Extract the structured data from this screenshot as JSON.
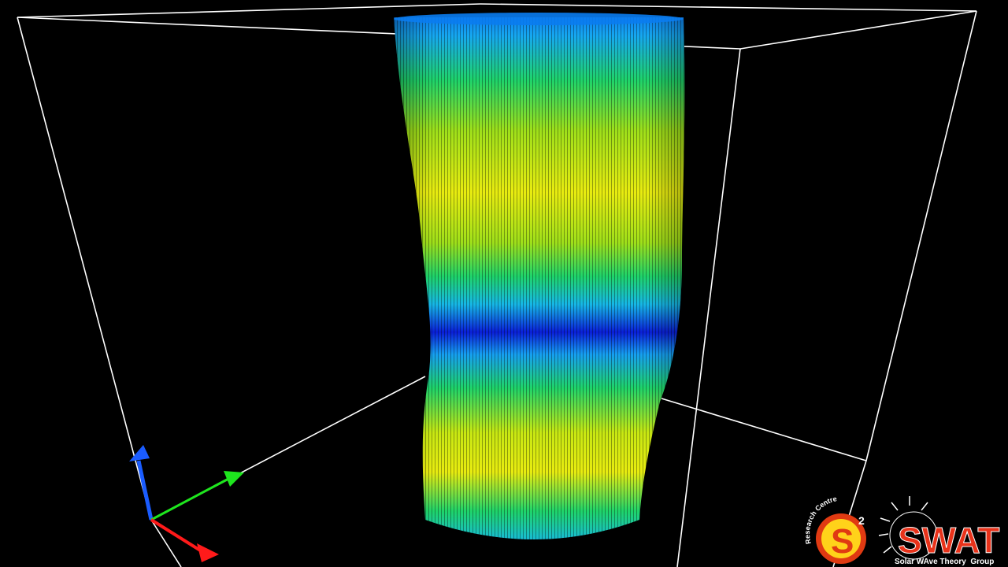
{
  "scene": {
    "background": "#000000",
    "box_edge_color": "#ffffff",
    "colormap": [
      "#0a1fd8",
      "#0a6cf0",
      "#16b8e6",
      "#1fd46a",
      "#8fe01a",
      "#e8ec10"
    ],
    "axes_colors": {
      "x": "#ff1a1a",
      "y": "#1ee61e",
      "z": "#1a5cff"
    }
  },
  "logos": {
    "research_centre": {
      "arc_text": "Research Centre",
      "mark": "S",
      "sup": "2",
      "colors": {
        "outer": "#e03a12",
        "inner": "#ffd21a"
      }
    },
    "swat": {
      "title": "SWAT",
      "subtitle": "Solar WAve Theory  Group",
      "colors": {
        "title": "#e8321a",
        "subtitle": "#ffffff"
      }
    }
  }
}
